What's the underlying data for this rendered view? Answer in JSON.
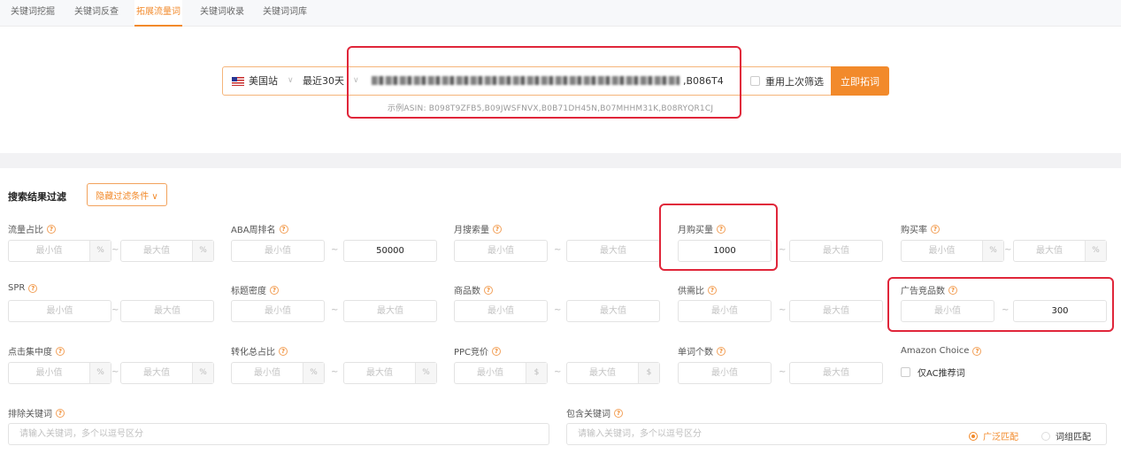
{
  "tabs": [
    "关键词挖掘",
    "关键词反查",
    "拓展流量词",
    "关键词收录",
    "关键词词库"
  ],
  "search": {
    "site": "美国站",
    "period": "最近30天",
    "asin_visible": ",B086T4",
    "reuse_label": "重用上次筛选",
    "submit_label": "立即拓词",
    "example": "示例ASIN:  B098T9ZFB5,B09JWSFNVX,B0B71DH45N,B07MHHM31K,B08RYQR1CJ"
  },
  "filter": {
    "title": "搜索结果过滤",
    "hide_label": "隐藏过滤条件 ∨",
    "min_ph": "最小值",
    "max_ph": "最大值",
    "dash": "~",
    "pct": "%",
    "dollar": "$",
    "labels": {
      "traffic_share": "流量占比",
      "aba_rank": "ABA周排名",
      "monthly_search": "月搜索量",
      "monthly_purchase": "月购买量",
      "purchase_rate": "购买率",
      "spr": "SPR",
      "title_density": "标题密度",
      "product_count": "商品数",
      "supply_demand": "供需比",
      "ad_competitors": "广告竞品数",
      "click_concentration": "点击集中度",
      "conversion_share": "转化总占比",
      "ppc_bid": "PPC竞价",
      "word_count": "单词个数",
      "amazon_choice": "Amazon Choice"
    },
    "values": {
      "aba_rank_max": "50000",
      "monthly_purchase_min": "1000",
      "ad_competitors_max": "300"
    },
    "ac_only": "仅AC推荐词",
    "exclude_label": "排除关键词",
    "include_label": "包含关键词",
    "keyword_ph": "请输入关键词，多个以逗号区分",
    "broad_match": "广泛匹配",
    "phrase_match": "词组匹配"
  }
}
